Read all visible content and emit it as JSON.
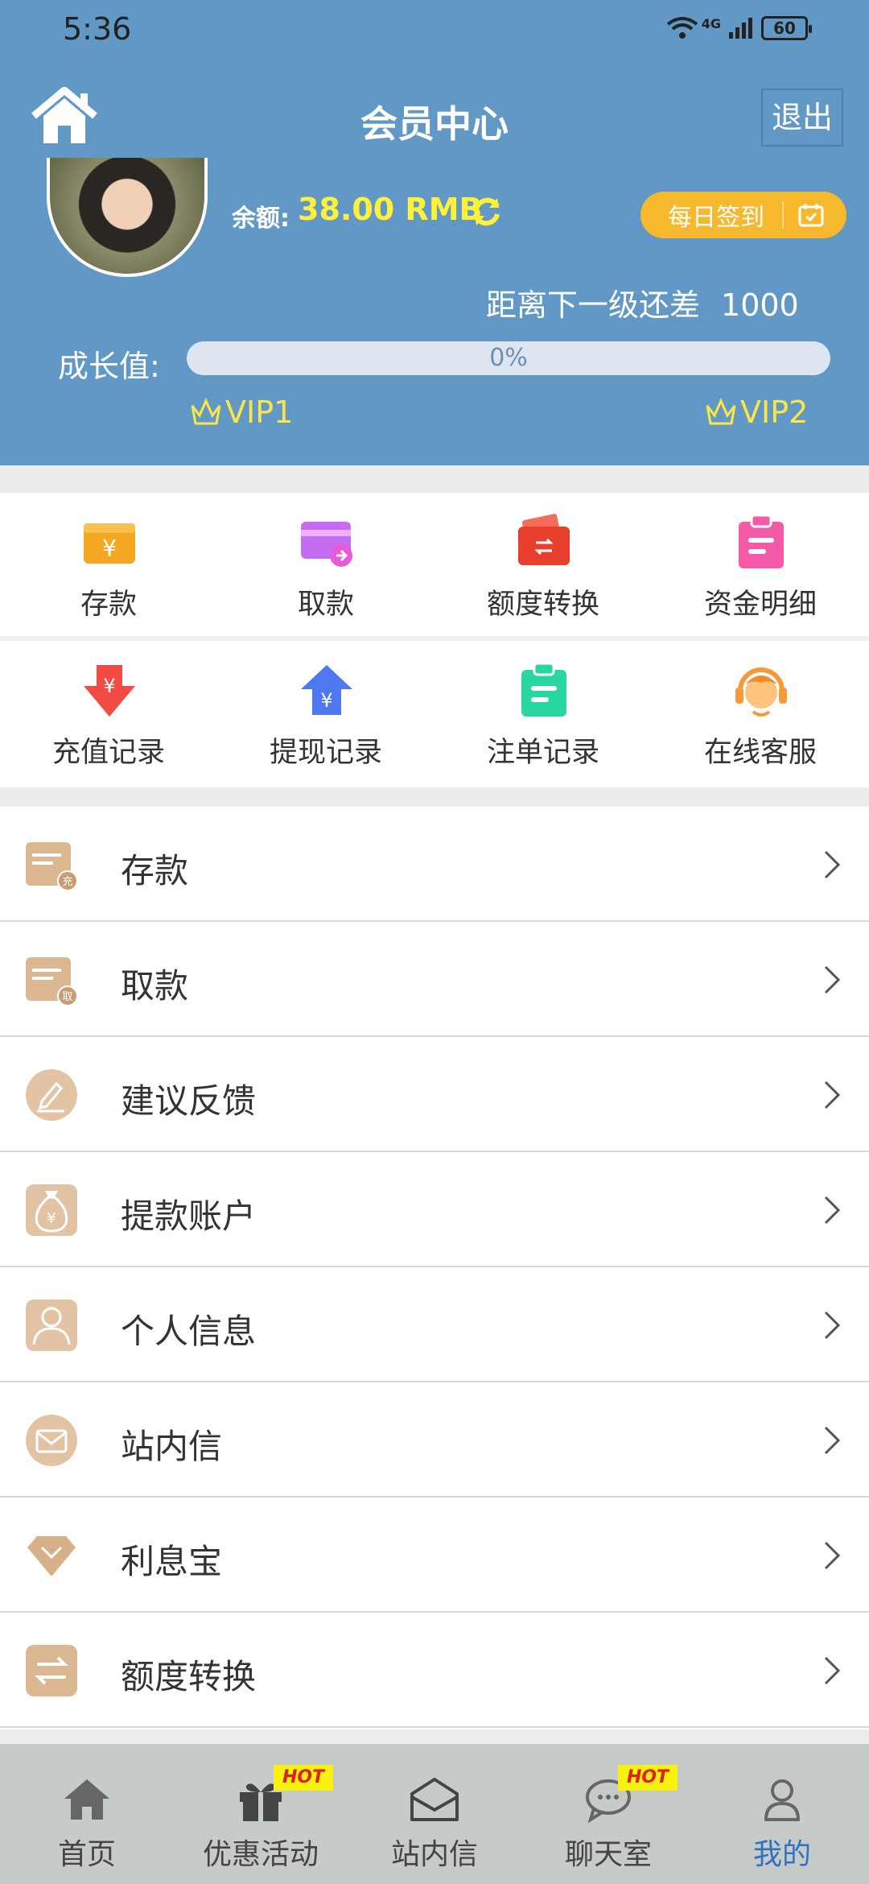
{
  "status": {
    "time": "5:36",
    "battery": "60",
    "network": "4G"
  },
  "header": {
    "title": "会员中心",
    "logout_label": "退出"
  },
  "account": {
    "balance_label": "余额:",
    "balance_value": "38.00 RMB",
    "signin_label": "每日签到",
    "next_level_label": "距离下一级还差",
    "next_level_value": "1000",
    "growth_label": "成长值:",
    "progress_text": "0%",
    "progress_fraction": 0,
    "vip_current": "VIP1",
    "vip_next": "VIP2"
  },
  "grid": [
    {
      "label": "存款",
      "icon": "deposit-wallet-icon"
    },
    {
      "label": "取款",
      "icon": "withdraw-card-icon"
    },
    {
      "label": "额度转换",
      "icon": "transfer-icon"
    },
    {
      "label": "资金明细",
      "icon": "funds-detail-icon"
    },
    {
      "label": "充值记录",
      "icon": "recharge-record-icon"
    },
    {
      "label": "提现记录",
      "icon": "withdraw-record-icon"
    },
    {
      "label": "注单记录",
      "icon": "bet-record-icon"
    },
    {
      "label": "在线客服",
      "icon": "customer-service-icon"
    }
  ],
  "menu": [
    {
      "label": "存款",
      "icon": "deposit-icon"
    },
    {
      "label": "取款",
      "icon": "withdraw-icon"
    },
    {
      "label": "建议反馈",
      "icon": "feedback-icon"
    },
    {
      "label": "提款账户",
      "icon": "money-bag-icon"
    },
    {
      "label": "个人信息",
      "icon": "user-icon"
    },
    {
      "label": "站内信",
      "icon": "mail-icon"
    },
    {
      "label": "利息宝",
      "icon": "diamond-icon"
    },
    {
      "label": "额度转换",
      "icon": "exchange-icon"
    }
  ],
  "nav": [
    {
      "label": "首页",
      "icon": "home-icon"
    },
    {
      "label": "优惠活动",
      "icon": "gift-icon",
      "badge": "HOT"
    },
    {
      "label": "站内信",
      "icon": "envelope-icon"
    },
    {
      "label": "聊天室",
      "icon": "chat-icon",
      "badge": "HOT"
    },
    {
      "label": "我的",
      "icon": "profile-icon"
    }
  ],
  "colors": {
    "header": "#6298c5",
    "accent_yellow": "#fff13a",
    "active_nav": "#2d72c4"
  }
}
